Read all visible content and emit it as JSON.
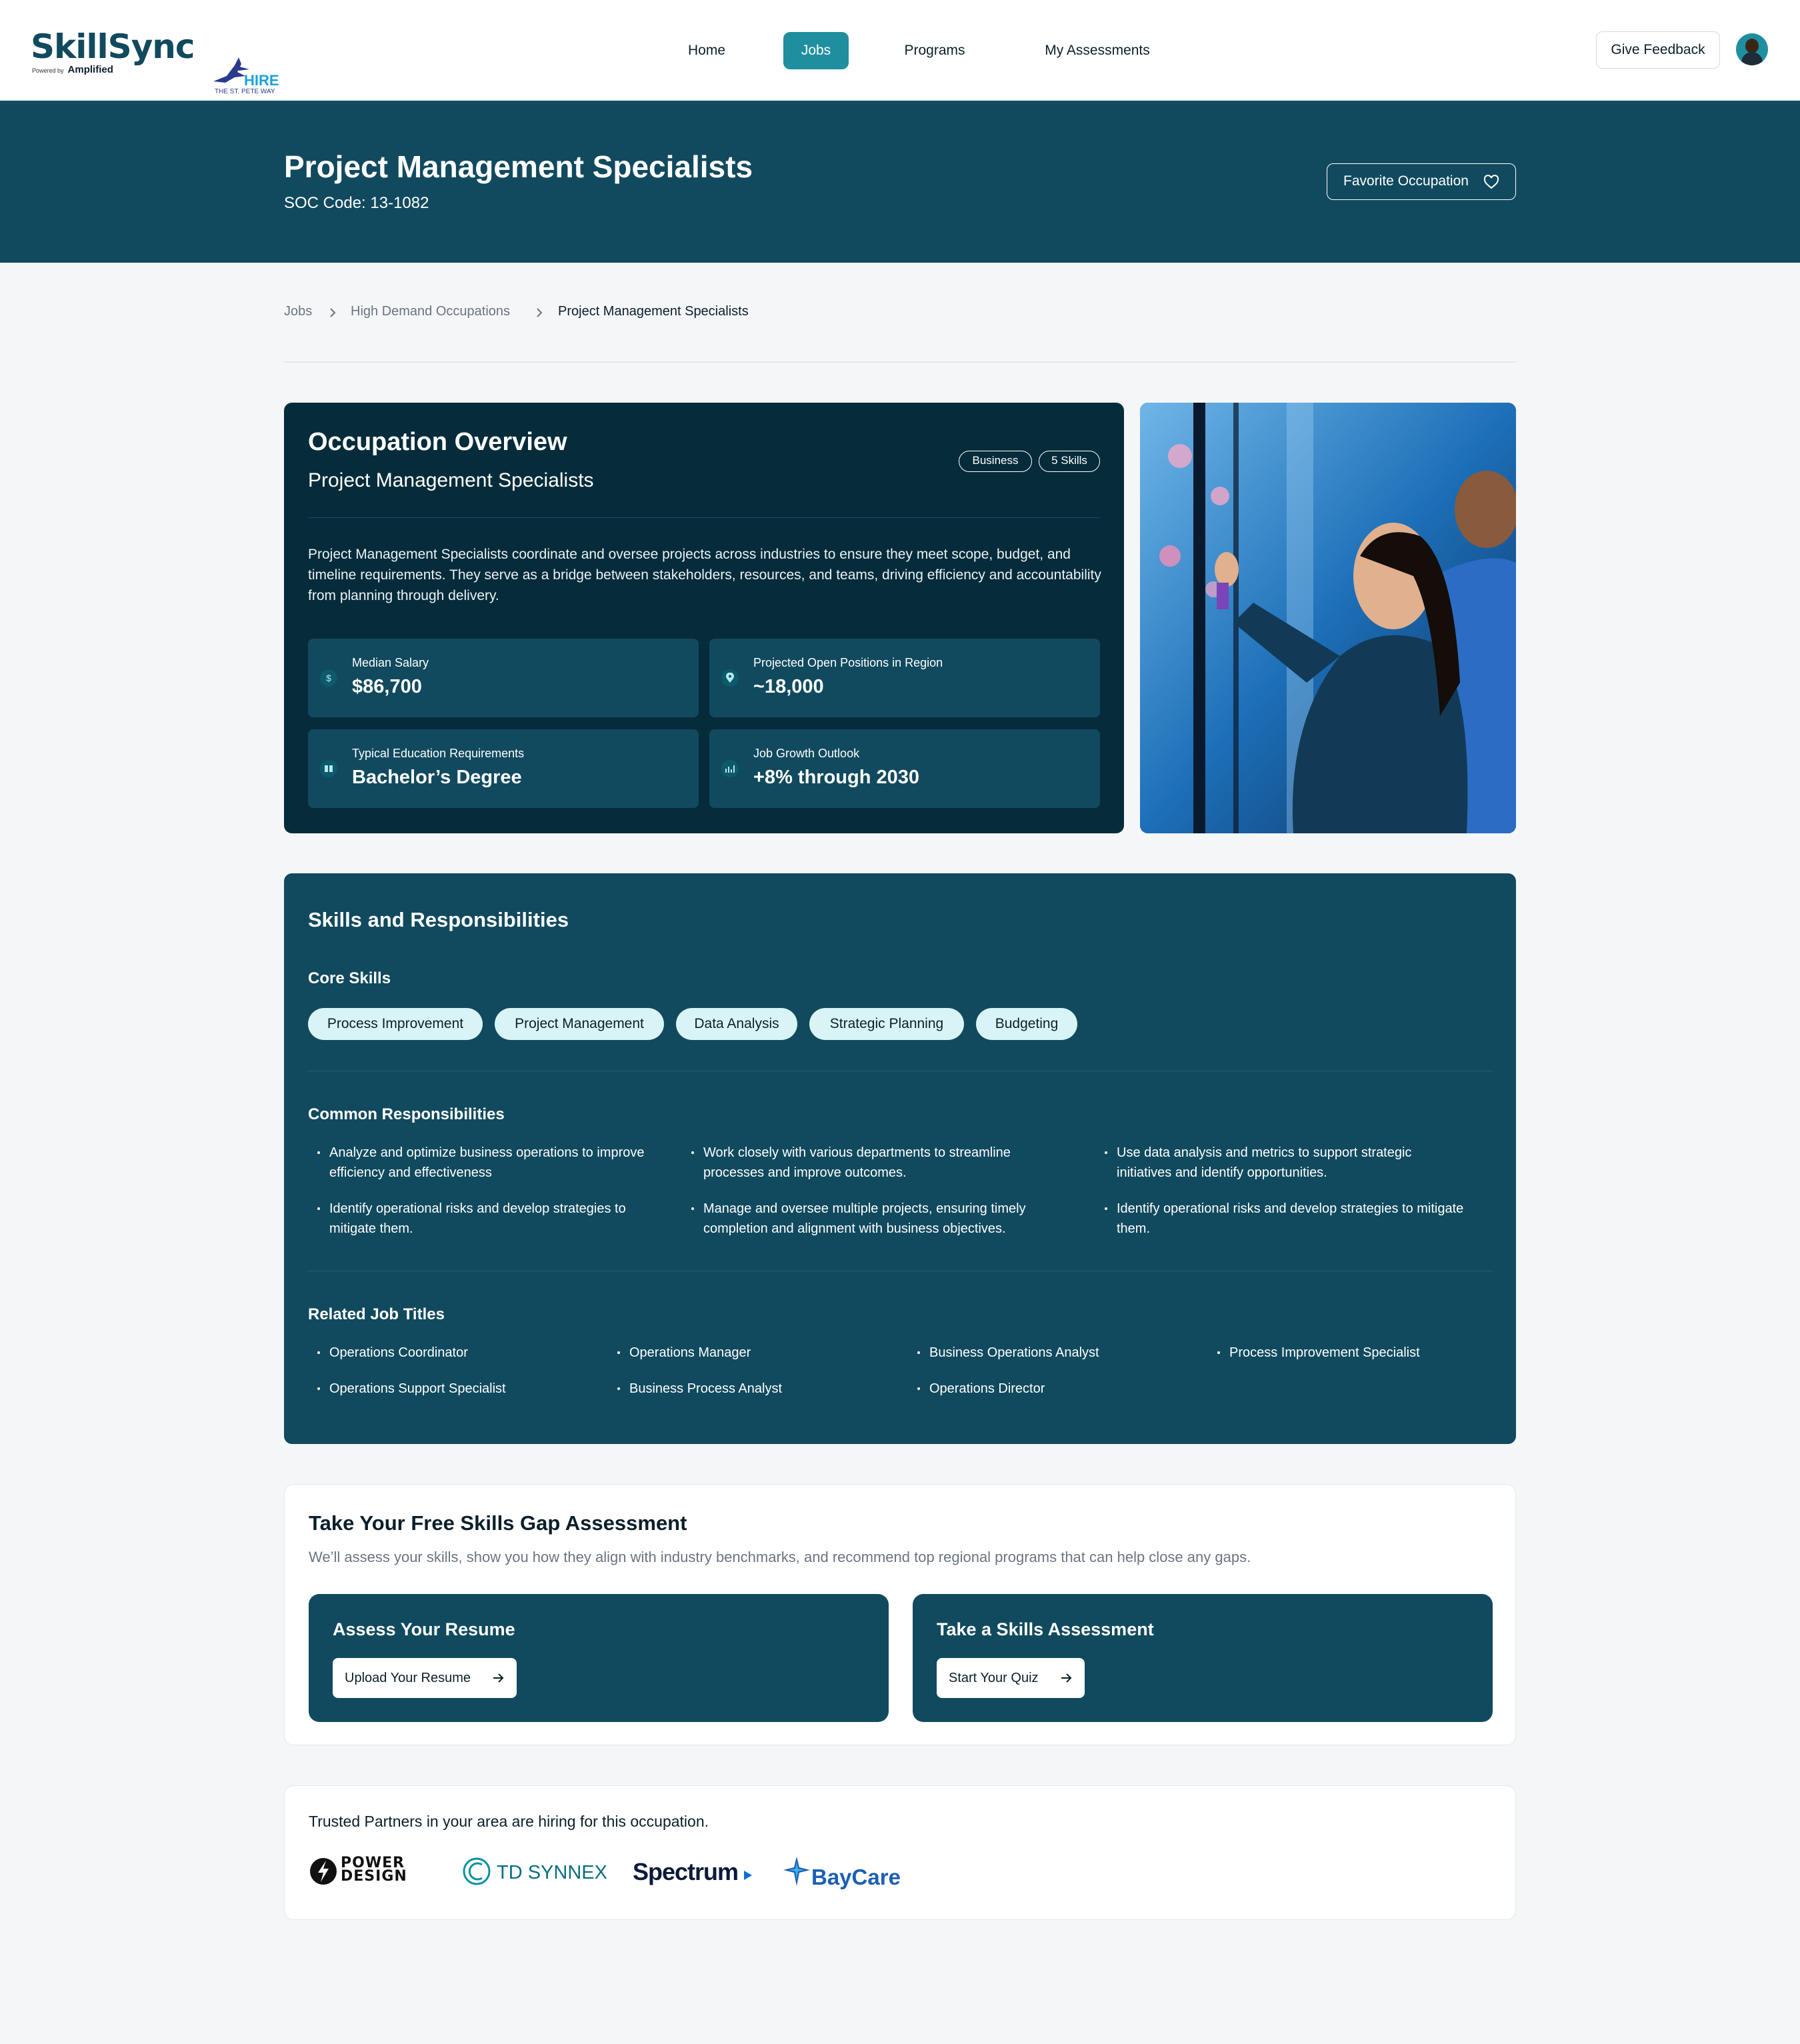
{
  "brand": {
    "name": "SkillSync",
    "powered_by": "Powered by",
    "powered_name": "Amplified",
    "partner_word": "HIRE",
    "partner_tag": "THE ST. PETE WAY"
  },
  "nav": {
    "items": [
      {
        "label": "Home",
        "active": false
      },
      {
        "label": "Jobs",
        "active": true
      },
      {
        "label": "Programs",
        "active": false
      },
      {
        "label": "My Assessments",
        "active": false
      }
    ],
    "feedback_label": "Give Feedback",
    "accent": "#1f8fa0"
  },
  "hero": {
    "title": "Project Management Specialists",
    "soc": "SOC Code: 13-1082",
    "favorite_label": "Favorite Occupation",
    "background": "#114a5e"
  },
  "breadcrumb": {
    "items": [
      "Jobs",
      "High Demand Occupations",
      "Project Management Specialists"
    ]
  },
  "overview": {
    "title": "Occupation Overview",
    "subtitle": "Project Management Specialists",
    "tags": [
      "Business",
      "5 Skills"
    ],
    "description": "Project Management Specialists coordinate and oversee projects across industries to ensure they meet scope, budget, and timeline requirements. They serve as a bridge between stakeholders, resources, and teams, driving efficiency and accountability from planning through delivery.",
    "stats": [
      {
        "icon": "dollar-icon",
        "label": "Median Salary",
        "value": "$86,700"
      },
      {
        "icon": "map-pin-icon",
        "label": "Projected Open Positions in Region",
        "value": "~18,000"
      },
      {
        "icon": "book-icon",
        "label": "Typical Education Requirements",
        "value": "Bachelor’s Degree"
      },
      {
        "icon": "chart-icon",
        "label": "Job Growth Outlook",
        "value": "+8% through 2030"
      }
    ]
  },
  "skills": {
    "title": "Skills and Responsibilities",
    "core_heading": "Core Skills",
    "core": [
      "Process Improvement",
      "Project Management",
      "Data Analysis",
      "Strategic Planning",
      "Budgeting"
    ],
    "resp_heading": "Common Responsibilities",
    "responsibilities": [
      "Analyze and optimize business operations to improve efficiency and effectiveness",
      "Work closely with various departments to streamline processes and improve outcomes.",
      "Use data analysis and metrics to support strategic initiatives and identify opportunities.",
      "Identify operational risks and develop strategies to mitigate them.",
      "Manage and oversee multiple projects, ensuring timely completion and alignment with business objectives.",
      "Identify operational risks and develop strategies to mitigate them."
    ],
    "jobs_heading": "Related Job Titles",
    "jobs": [
      "Operations Coordinator",
      "Operations Manager",
      "Business Operations Analyst",
      "Process Improvement Specialist",
      "Operations Support Specialist",
      "Business Process Analyst",
      "Operations Director"
    ]
  },
  "assessment": {
    "title": "Take Your Free Skills Gap Assessment",
    "description": "We’ll assess your skills, show you how they align with industry benchmarks, and recommend top regional programs that can help close any gaps.",
    "cards": [
      {
        "title": "Assess Your Resume",
        "button": "Upload Your Resume"
      },
      {
        "title": "Take a Skills Assessment",
        "button": "Start Your Quiz"
      }
    ]
  },
  "partners": {
    "title": "Trusted Partners in your area are hiring for this occupation.",
    "logos": [
      "POWER DESIGN",
      "TD SYNNEX",
      "Spectrum",
      "BayCare"
    ]
  }
}
